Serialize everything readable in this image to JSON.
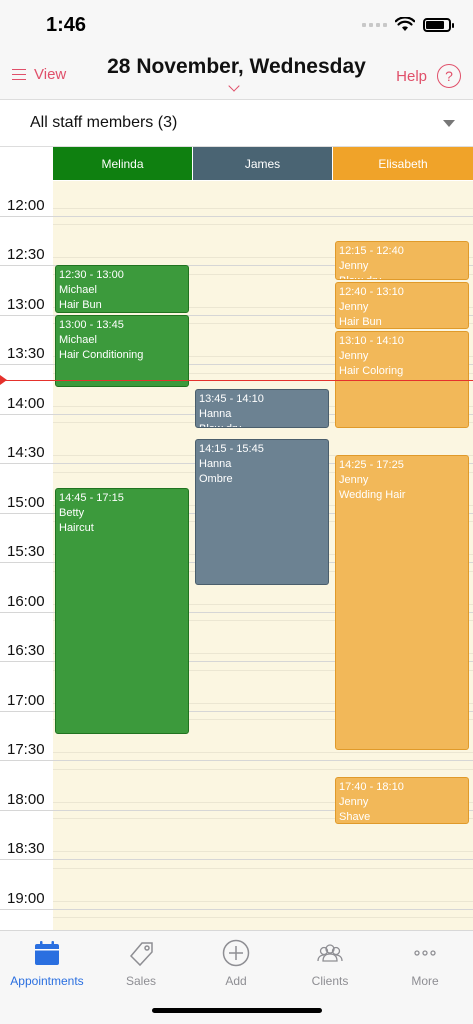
{
  "status": {
    "time": "1:46"
  },
  "nav": {
    "view_label": "View",
    "title": "28 November, Wednesday",
    "help_label": "Help",
    "help_symbol": "?"
  },
  "staff_filter": {
    "label": "All staff members (3)"
  },
  "staff": [
    {
      "name": "Melinda",
      "color": "#0f8010"
    },
    {
      "name": "James",
      "color": "#4a6473"
    },
    {
      "name": "Elisabeth",
      "color": "#f0a329"
    }
  ],
  "times": [
    "12:00",
    "12:30",
    "13:00",
    "13:30",
    "14:00",
    "14:30",
    "15:00",
    "15:30",
    "16:00",
    "16:30",
    "17:00",
    "17:30",
    "18:00",
    "18:30",
    "19:00"
  ],
  "appointments": {
    "melinda": [
      {
        "time": "12:30 - 13:00",
        "client": "Michael",
        "service": "Hair Bun"
      },
      {
        "time": "13:00 - 13:45",
        "client": "Michael",
        "service": "Hair Conditioning"
      },
      {
        "time": "14:45 - 17:15",
        "client": "Betty",
        "service": "Haircut"
      }
    ],
    "james": [
      {
        "time": "13:45 - 14:10",
        "client": "Hanna",
        "service": "Blow dry"
      },
      {
        "time": "14:15 - 15:45",
        "client": "Hanna",
        "service": "Ombre"
      }
    ],
    "elisabeth": [
      {
        "time": "12:15 - 12:40",
        "client": "Jenny",
        "service": "Blow dry"
      },
      {
        "time": "12:40 - 13:10",
        "client": "Jenny",
        "service": "Hair Bun"
      },
      {
        "time": "13:10 - 14:10",
        "client": "Jenny",
        "service": "Hair Coloring"
      },
      {
        "time": "14:25 - 17:25",
        "client": "Jenny",
        "service": "Wedding Hair"
      },
      {
        "time": "17:40 - 18:10",
        "client": "Jenny",
        "service": "Shave"
      }
    ]
  },
  "tabs": [
    {
      "label": "Appointments",
      "icon": "calendar-icon",
      "active": true
    },
    {
      "label": "Sales",
      "icon": "tag-icon",
      "active": false
    },
    {
      "label": "Add",
      "icon": "add-circle-icon",
      "active": false
    },
    {
      "label": "Clients",
      "icon": "clients-icon",
      "active": false
    },
    {
      "label": "More",
      "icon": "more-icon",
      "active": false
    }
  ],
  "colors": {
    "accent": "#e0506a",
    "now_line": "#e5312c",
    "active_tab": "#2a6fe0"
  }
}
